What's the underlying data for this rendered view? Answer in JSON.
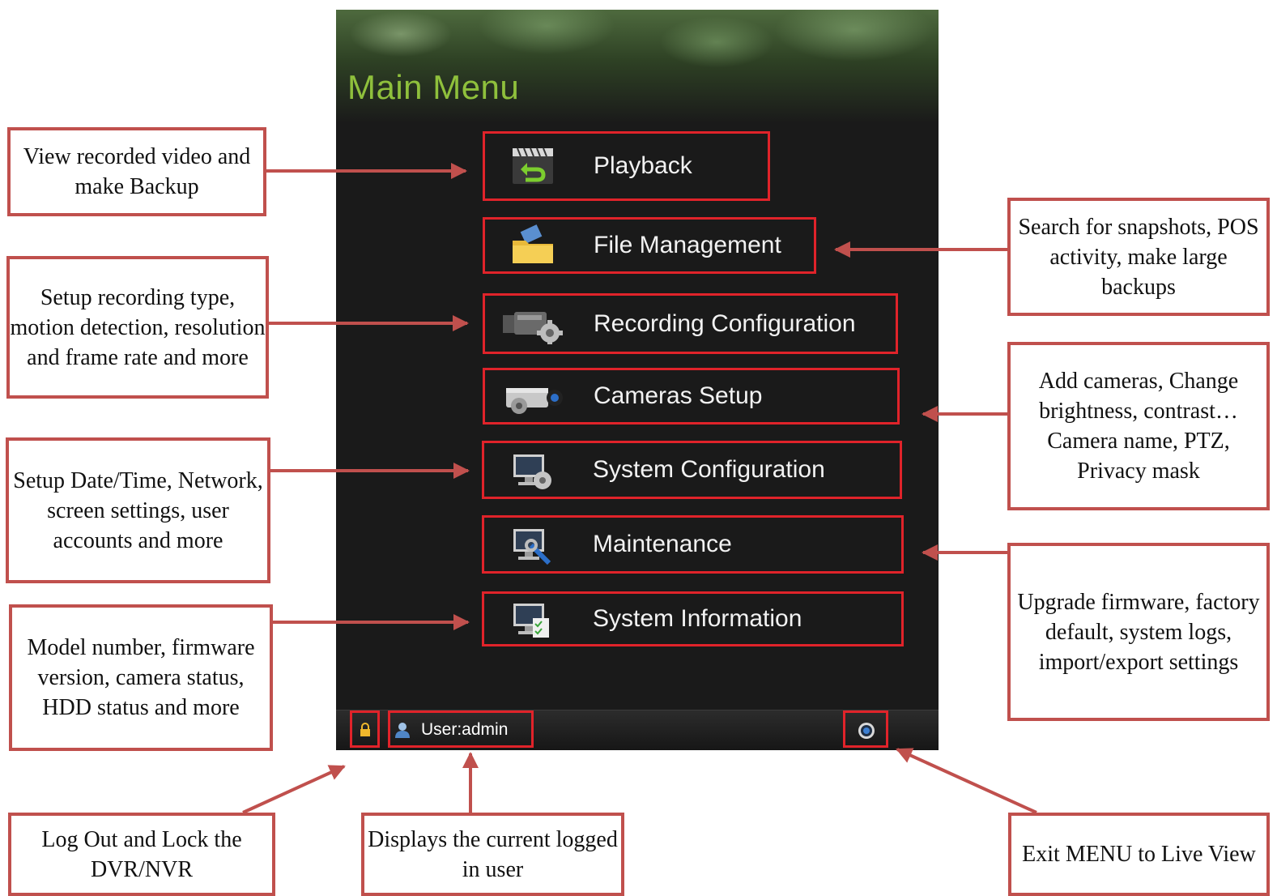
{
  "main_menu": {
    "title": "Main Menu",
    "items": [
      {
        "label": "Playback",
        "icon": "playback-clapper-icon"
      },
      {
        "label": "File Management",
        "icon": "folder-icon"
      },
      {
        "label": "Recording Configuration",
        "icon": "video-camera-gear-icon"
      },
      {
        "label": "Cameras Setup",
        "icon": "camera-gear-icon"
      },
      {
        "label": "System Configuration",
        "icon": "monitor-gear-icon"
      },
      {
        "label": "Maintenance",
        "icon": "monitor-wrench-icon"
      },
      {
        "label": "System Information",
        "icon": "monitor-checklist-icon"
      }
    ]
  },
  "status_bar": {
    "user_label": "User:admin",
    "lock_icon": "lock-icon",
    "user_icon": "user-icon",
    "exit_icon": "exit-live-view-icon"
  },
  "annotations": {
    "playback": "View recorded video and make Backup",
    "recording": "Setup recording type, motion detection, resolution and frame rate and more",
    "system_config": "Setup Date/Time, Network, screen settings, user accounts and more",
    "system_info": "Model number, firmware version, camera status, HDD status and more",
    "file_management": "Search for snapshots, POS activity, make large backups",
    "cameras": "Add cameras, Change brightness, contrast… Camera name, PTZ, Privacy mask",
    "maintenance": "Upgrade firmware, factory default, system logs, import/export settings",
    "logout": "Log Out and Lock the DVR/NVR",
    "current_user": "Displays the current logged in user",
    "exit": "Exit MENU to Live View"
  },
  "colors": {
    "highlight": "#e0232a",
    "callout_border": "#c0504d",
    "title_green": "#8fc03c",
    "screen_bg": "#1a1a1a"
  }
}
